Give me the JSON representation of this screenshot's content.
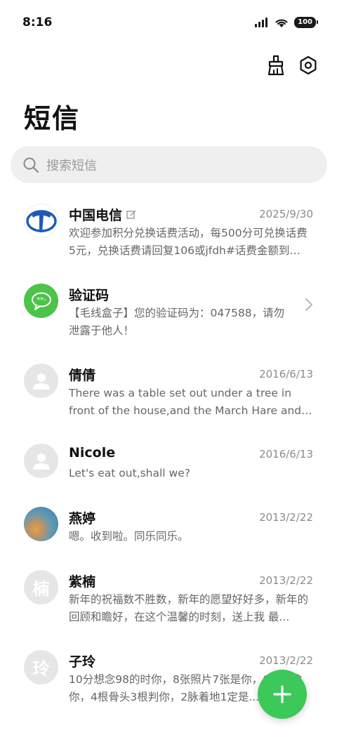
{
  "status_bar": {
    "time": "8:16",
    "battery": "100"
  },
  "header": {
    "title": "短信"
  },
  "search": {
    "placeholder": "搜索短信"
  },
  "conversations": [
    {
      "name": "中国电信",
      "date": "2025/9/30",
      "preview": "欢迎参加积分兑换话费活动，每500分可兑换话费5元，兑换话费请回复106或jfdh#话费金额到10...",
      "avatar": "telecom-logo-icon"
    },
    {
      "name": "验证码",
      "date": "",
      "preview": "【毛线盒子】您的验证码为：047588，请勿泄露于他人！",
      "avatar": "chat-bubble-icon"
    },
    {
      "name": "倩倩",
      "date": "2016/6/13",
      "preview": "There was a table set out under a tree in front of the house,and the March Hare and th...",
      "avatar": "person-icon"
    },
    {
      "name": "Nicole",
      "date": "2016/6/13",
      "preview": "Let's eat out,shall we?",
      "avatar": "person-icon"
    },
    {
      "name": "燕婷",
      "date": "2013/2/22",
      "preview": "嗯。收到啦。同乐同乐。",
      "avatar": "photo"
    },
    {
      "name": "紫楠",
      "date": "2013/2/22",
      "preview": "新年的祝福数不胜数，新年的愿望好好多，新年的回顾和瞻好，在这个温馨的时刻，送上我 最...",
      "avatar_text": "楠"
    },
    {
      "name": "子玲",
      "date": "2013/2/22",
      "preview": "10分想念98的时你，8张照片7张是你，6时候像你，4根骨头3根判你，2脉着地1定是...",
      "avatar_text": "玲"
    }
  ],
  "colors": {
    "accent_green": "#3cc95a",
    "telecom_blue": "#1e5bb8"
  }
}
